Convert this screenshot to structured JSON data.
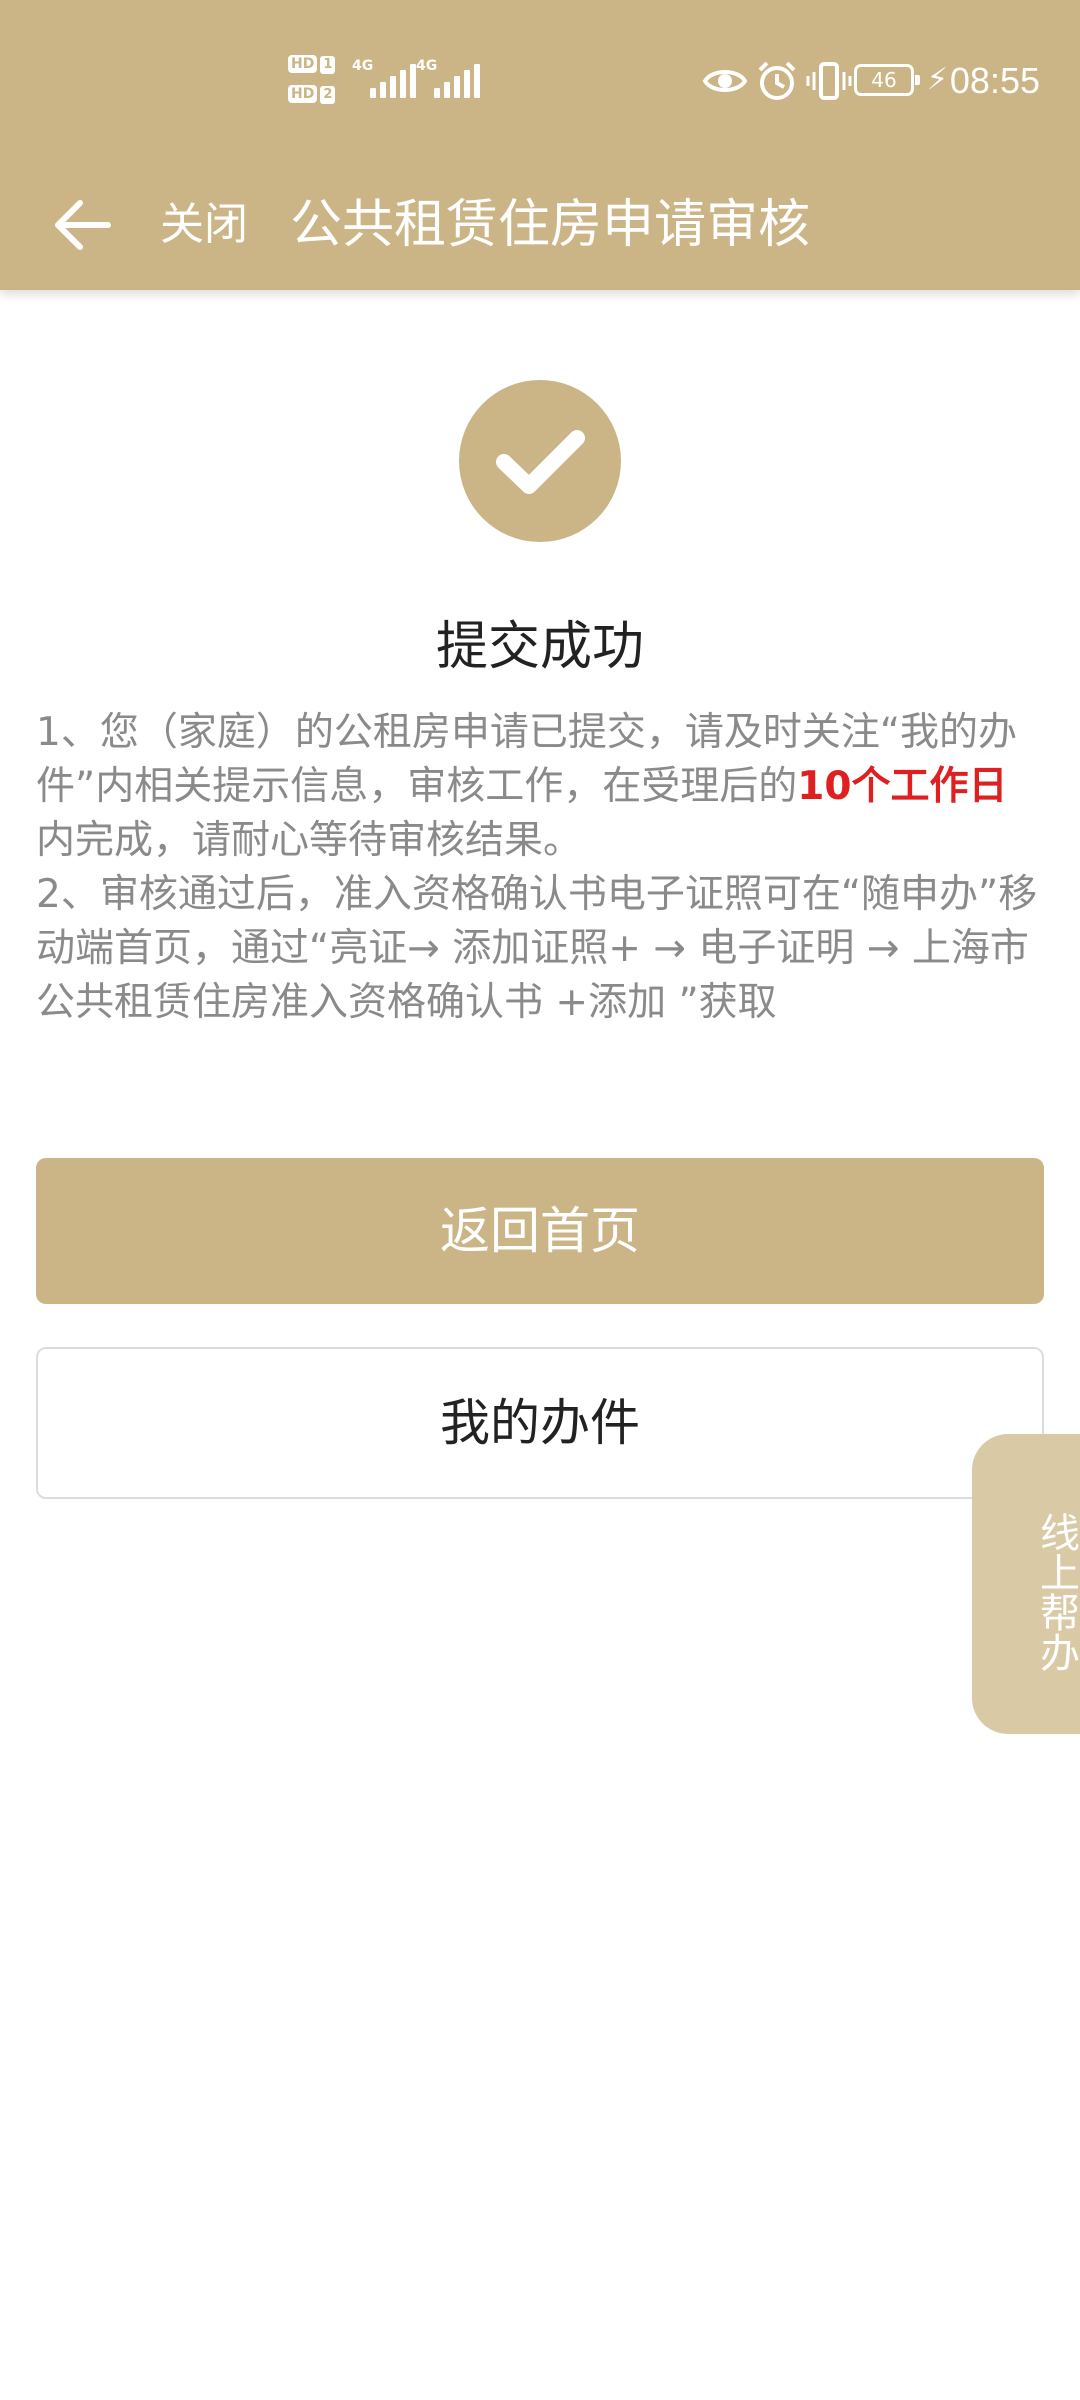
{
  "status_bar": {
    "sim1_label": "HD",
    "sim1_num": "1",
    "sim2_label": "HD",
    "sim2_num": "2",
    "network1": "4G",
    "network2": "4G",
    "battery": "46",
    "time": "08:55",
    "icons": [
      "eye-icon",
      "alarm-icon",
      "vibrate-icon",
      "battery-icon",
      "charging-icon"
    ]
  },
  "nav": {
    "back_icon": "arrow-left-icon",
    "close_label": "关闭",
    "title": "公共租赁住房申请审核"
  },
  "result": {
    "icon": "checkmark-icon",
    "title": "提交成功",
    "para1_part1": "1、您（家庭）的公租房申请已提交，请及时关注“我的办件”内相关提示信息，审核工作，在受理后的",
    "para1_highlight": "10个工作日",
    "para1_part2": "内完成，请耐心等待审核结果。",
    "para2": "2、审核通过后，准入资格确认书电子证照可在“随申办”移动端首页，通过“亮证→ 添加证照+ → 电子证明 → 上海市公共租赁住房准入资格确认书 +添加 ”获取"
  },
  "buttons": {
    "home": "返回首页",
    "my_cases": "我的办件"
  },
  "float_tab": {
    "label": "线上帮办"
  },
  "colors": {
    "brand": "#CBB586",
    "float_tab": "#D9C9A5",
    "highlight": "#e02020",
    "body_text": "#8a8a8a"
  }
}
